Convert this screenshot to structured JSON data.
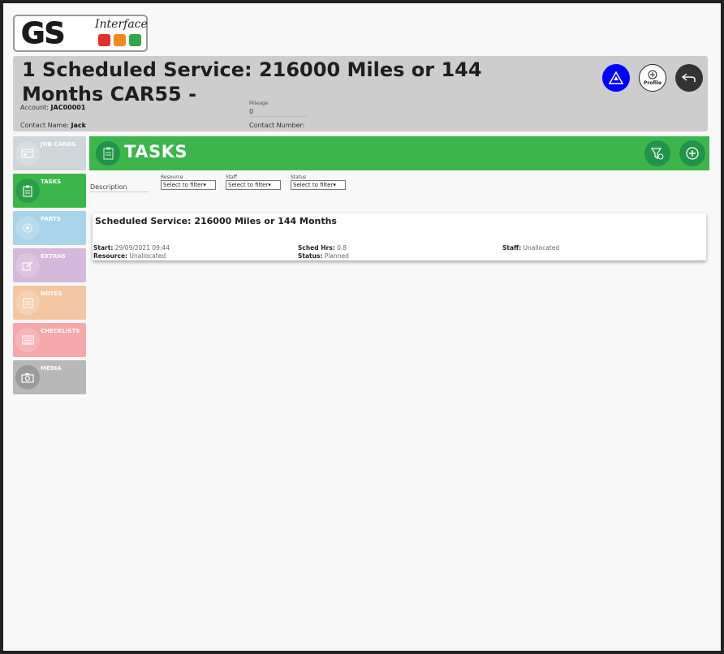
{
  "logo": {
    "main_text": "GS",
    "sub_text": "Interface"
  },
  "header": {
    "title": "1 Scheduled Service: 216000 Miles or 144 Months CAR55 -",
    "account_label": "Account:",
    "account_value": "JAC00001",
    "mileage_label": "Mileage",
    "mileage_value": "0",
    "contact_name_label": "Contact Name:",
    "contact_name_value": "Jack",
    "contact_number_label": "Contact Number:",
    "contact_number_value": "",
    "profile_label": "Profile"
  },
  "sidebar": {
    "items": [
      {
        "label": "JOB CARDS",
        "color": "#cfd6d9",
        "icon": "card-icon"
      },
      {
        "label": "TASKS",
        "color": "#3cb64a",
        "icon": "clipboard-icon"
      },
      {
        "label": "PARTS",
        "color": "#a8d3e8",
        "icon": "cog-icon"
      },
      {
        "label": "EXTRAS",
        "color": "#d6b8dc",
        "icon": "edit-icon"
      },
      {
        "label": "NOTES",
        "color": "#f3c6a3",
        "icon": "note-icon"
      },
      {
        "label": "CHECKLISTS",
        "color": "#f5a7aa",
        "icon": "list-icon"
      },
      {
        "label": "MEDIA",
        "color": "#b8b8b8",
        "icon": "camera-icon"
      }
    ]
  },
  "tasks": {
    "title": "TASKS",
    "filters": {
      "description_label": "Description",
      "resource_label": "Resource",
      "resource_value": "Select to filter",
      "staff_label": "Staff",
      "staff_value": "Select to filter",
      "status_label": "Status",
      "status_value": "Select to filter"
    },
    "card": {
      "title": "Scheduled Service: 216000 Miles or 144 Months",
      "start_label": "Start:",
      "start_value": "29/09/2021 09:44",
      "resource_label": "Resource:",
      "resource_value": "Unallocated",
      "sched_label": "Sched Hrs:",
      "sched_value": "0.8",
      "status_label": "Status:",
      "status_value": "Planned",
      "staff_label": "Staff:",
      "staff_value": "Unallocated"
    }
  },
  "colors": {
    "accent_green": "#3cb64a",
    "mot_blue": "#0000ff",
    "header_grey": "#cdcdcd"
  }
}
